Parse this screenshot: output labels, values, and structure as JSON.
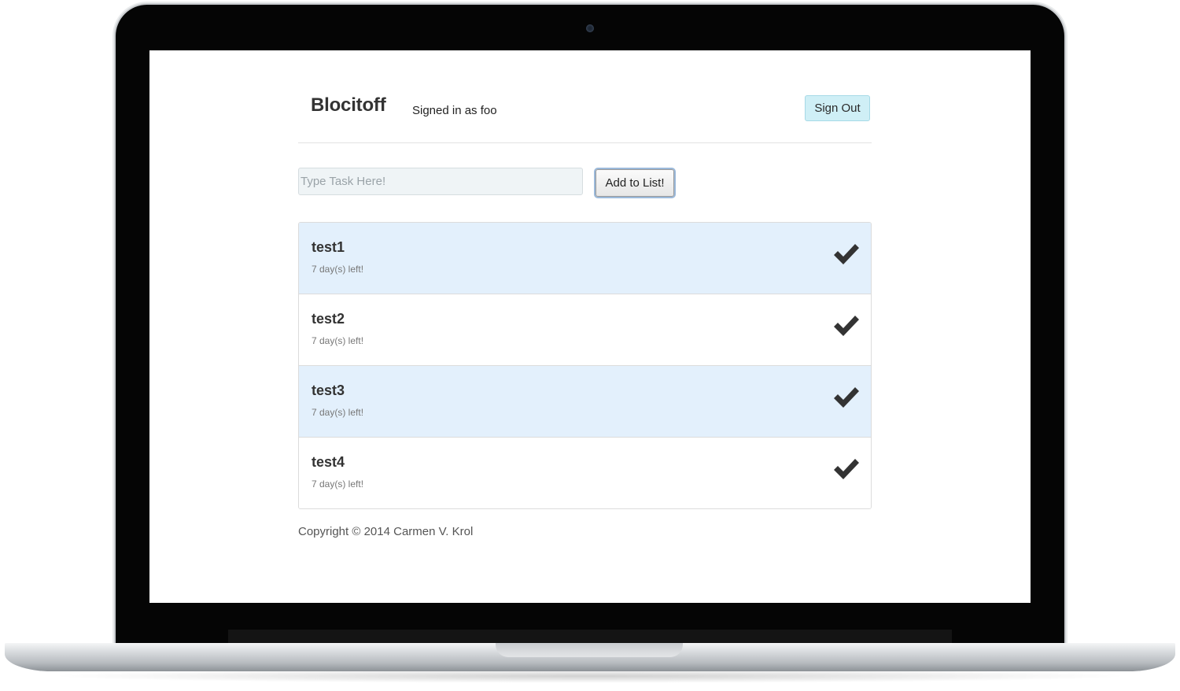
{
  "header": {
    "brand": "Blocitoff",
    "signed_in_text": "Signed in as foo",
    "sign_out_label": "Sign Out"
  },
  "task_form": {
    "placeholder": "Type Task Here!",
    "value": "",
    "submit_label": "Add to List!"
  },
  "tasks": [
    {
      "name": "test1",
      "due": "7 day(s) left!",
      "icon": "check-icon"
    },
    {
      "name": "test2",
      "due": "7 day(s) left!",
      "icon": "check-icon"
    },
    {
      "name": "test3",
      "due": "7 day(s) left!",
      "icon": "check-icon"
    },
    {
      "name": "test4",
      "due": "7 day(s) left!",
      "icon": "check-icon"
    }
  ],
  "footer": {
    "copyright": "Copyright © 2014 Carmen V. Krol"
  },
  "colors": {
    "sign_out_bg": "#cfeff6",
    "alt_row_bg": "#e3f0fc",
    "check": "#333333"
  }
}
